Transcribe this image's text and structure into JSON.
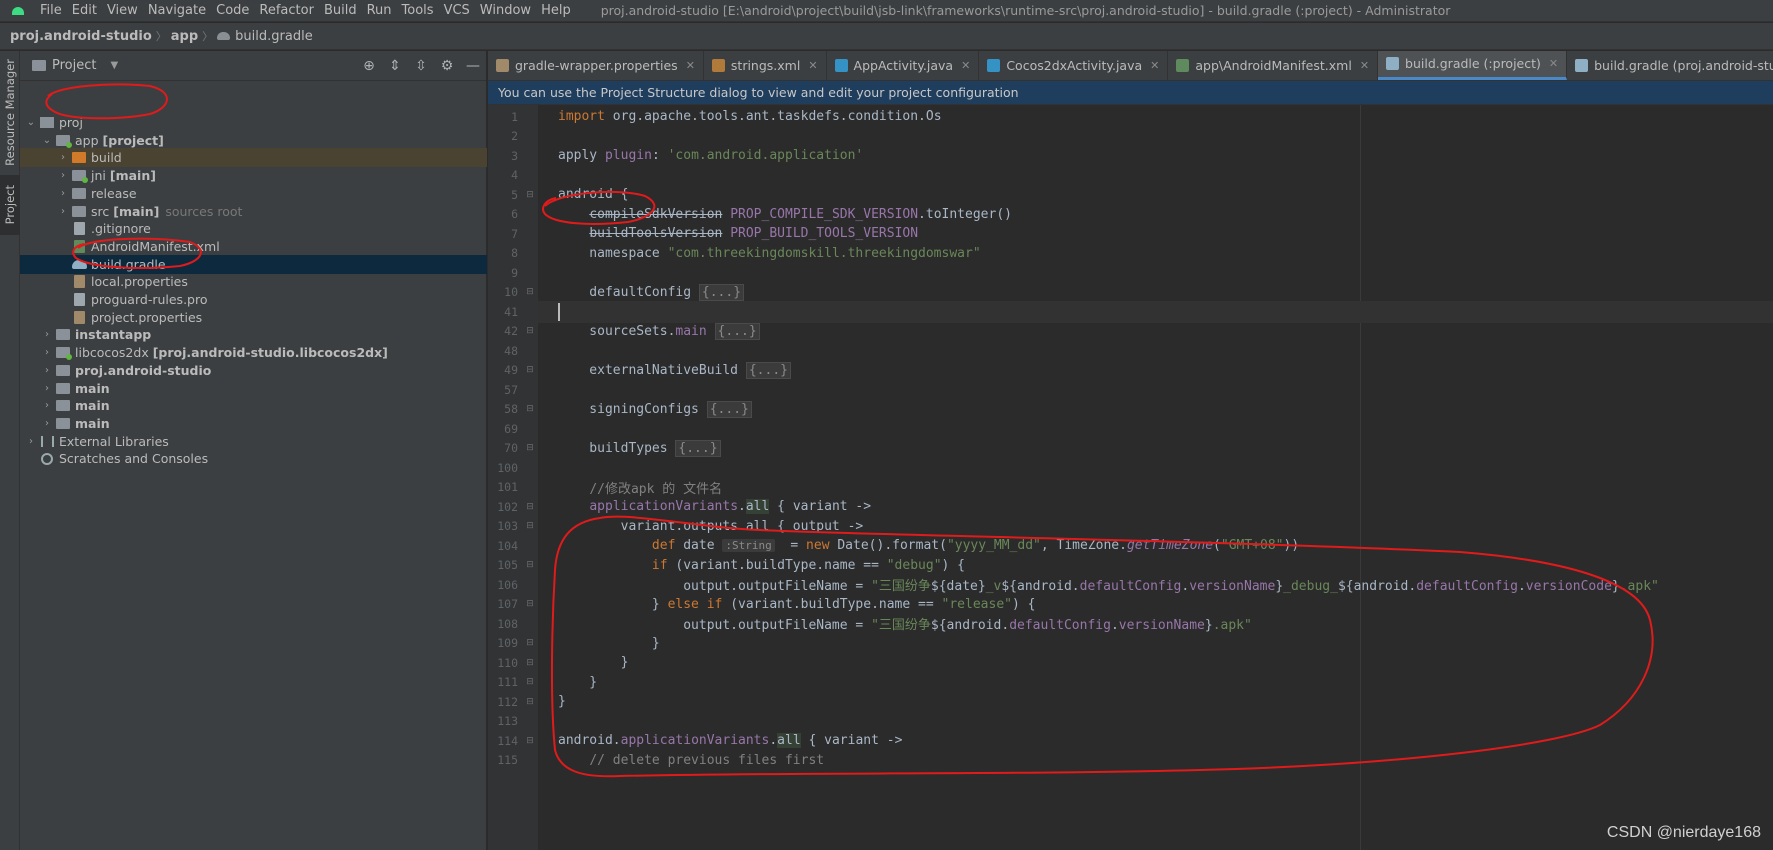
{
  "menu": {
    "items": [
      "File",
      "Edit",
      "View",
      "Navigate",
      "Code",
      "Refactor",
      "Build",
      "Run",
      "Tools",
      "VCS",
      "Window",
      "Help"
    ],
    "window_title": "proj.android-studio [E:\\android\\project\\build\\jsb-link\\frameworks\\runtime-src\\proj.android-studio] - build.gradle (:project) - Administrator"
  },
  "breadcrumb": [
    "proj.android-studio",
    "app",
    "build.gradle"
  ],
  "side_tabs": {
    "resource_manager": "Resource Manager",
    "project": "Project"
  },
  "panel": {
    "title": "Project"
  },
  "tree": [
    {
      "indent": 0,
      "arrow": "down",
      "icon": "project",
      "name": "proj",
      "bold": false
    },
    {
      "indent": 1,
      "arrow": "down",
      "icon": "module",
      "name": "app",
      "extra": "[project]",
      "bold": false
    },
    {
      "indent": 2,
      "arrow": "right",
      "icon": "folder-orange",
      "name": "build",
      "hl": "build"
    },
    {
      "indent": 2,
      "arrow": "right",
      "icon": "module",
      "name": "jni",
      "extra": "[main]"
    },
    {
      "indent": 2,
      "arrow": "right",
      "icon": "folder",
      "name": "release"
    },
    {
      "indent": 2,
      "arrow": "right",
      "icon": "folder",
      "name": "src",
      "extra": "[main]",
      "hint": "sources root"
    },
    {
      "indent": 2,
      "arrow": "",
      "icon": "file",
      "name": ".gitignore"
    },
    {
      "indent": 2,
      "arrow": "",
      "icon": "xml",
      "name": "AndroidManifest.xml"
    },
    {
      "indent": 2,
      "arrow": "",
      "icon": "gradle",
      "name": "build.gradle",
      "hl": "selected"
    },
    {
      "indent": 2,
      "arrow": "",
      "icon": "props",
      "name": "local.properties"
    },
    {
      "indent": 2,
      "arrow": "",
      "icon": "file",
      "name": "proguard-rules.pro"
    },
    {
      "indent": 2,
      "arrow": "",
      "icon": "props",
      "name": "project.properties"
    },
    {
      "indent": 1,
      "arrow": "right",
      "icon": "folder",
      "name": "instantapp",
      "bold": true
    },
    {
      "indent": 1,
      "arrow": "right",
      "icon": "module",
      "name": "libcocos2dx",
      "extra": "[proj.android-studio.libcocos2dx]"
    },
    {
      "indent": 1,
      "arrow": "right",
      "icon": "folder",
      "name": "proj.android-studio",
      "bold": true
    },
    {
      "indent": 1,
      "arrow": "right",
      "icon": "folder",
      "name": "main",
      "bold": true
    },
    {
      "indent": 1,
      "arrow": "right",
      "icon": "folder",
      "name": "main",
      "bold": true
    },
    {
      "indent": 1,
      "arrow": "right",
      "icon": "folder",
      "name": "main",
      "bold": true
    },
    {
      "indent": 0,
      "arrow": "right",
      "icon": "lib",
      "name": "External Libraries"
    },
    {
      "indent": 0,
      "arrow": "",
      "icon": "scratch",
      "name": "Scratches and Consoles"
    }
  ],
  "tabs": [
    {
      "label": "gradle-wrapper.properties",
      "color": "#a08a6a"
    },
    {
      "label": "strings.xml",
      "color": "#b07a3a"
    },
    {
      "label": "AppActivity.java",
      "color": "#3592c4"
    },
    {
      "label": "Cocos2dxActivity.java",
      "color": "#3592c4"
    },
    {
      "label": "app\\AndroidManifest.xml",
      "color": "#5e8a5e"
    },
    {
      "label": "build.gradle (:project)",
      "color": "#8fb0c4",
      "active": true
    },
    {
      "label": "build.gradle (proj.android-studio)",
      "color": "#8fb0c4"
    }
  ],
  "notice": "You can use the Project Structure dialog to view and edit your project configuration",
  "code_lines": [
    {
      "n": "1",
      "html": "<span class=\"kw\">import</span> org.apache.tools.ant.taskdefs.condition.Os"
    },
    {
      "n": "2",
      "html": ""
    },
    {
      "n": "3",
      "html": "apply <span class=\"prop\">plugin</span>: <span class=\"str\">'com.android.application'</span>"
    },
    {
      "n": "4",
      "html": ""
    },
    {
      "n": "5",
      "html": "android {",
      "fold": true
    },
    {
      "n": "6",
      "html": "    <span class=\"strike\">compileSdkVersion</span> <span class=\"prop\">PROP_COMPILE_SDK_VERSION</span>.toInteger()"
    },
    {
      "n": "7",
      "html": "    <span class=\"strike\">buildToolsVersion</span> <span class=\"prop\">PROP_BUILD_TOOLS_VERSION</span>"
    },
    {
      "n": "8",
      "html": "    namespace <span class=\"str\">\"com.threekingdomskill.threekingdomswar\"</span>"
    },
    {
      "n": "9",
      "html": ""
    },
    {
      "n": "10",
      "html": "    defaultConfig <span class=\"fold-box\">{...}</span>",
      "fold": true
    },
    {
      "n": "41",
      "html": "<span class=\"caret-bar\"></span>",
      "current": true
    },
    {
      "n": "42",
      "html": "    sourceSets.<span class=\"prop\">main</span> <span class=\"fold-box\">{...}</span>",
      "fold": true
    },
    {
      "n": "48",
      "html": ""
    },
    {
      "n": "49",
      "html": "    externalNativeBuild <span class=\"fold-box\">{...}</span>",
      "fold": true
    },
    {
      "n": "57",
      "html": ""
    },
    {
      "n": "58",
      "html": "    signingConfigs <span class=\"fold-box\">{...}</span>",
      "fold": true
    },
    {
      "n": "69",
      "html": ""
    },
    {
      "n": "70",
      "html": "    buildTypes <span class=\"fold-box\">{...}</span>",
      "fold": true
    },
    {
      "n": "100",
      "html": ""
    },
    {
      "n": "101",
      "html": "    <span class=\"cmt\">//修改apk 的 文件名</span>"
    },
    {
      "n": "102",
      "html": "    <span class=\"prop\">applicationVariants</span>.<span class=\"ref-hl\">all</span> { variant -&gt;",
      "fold": true
    },
    {
      "n": "103",
      "html": "        variant.outputs.all { output -&gt;",
      "fold": true
    },
    {
      "n": "104",
      "html": "            <span class=\"kw\">def</span> date <span class=\"hint-inline\">:String</span>  = <span class=\"kw\">new</span> Date().format(<span class=\"str\">\"yyyy_MM_dd\"</span>, TimeZone.<span class=\"itl\">getTimeZone</span>(<span class=\"str\">\"GMT+08\"</span>))"
    },
    {
      "n": "105",
      "html": "            <span class=\"kw\">if</span> (variant.buildType.name == <span class=\"str\">\"debug\"</span>) {",
      "fold": true
    },
    {
      "n": "106",
      "html": "                output.outputFileName = <span class=\"str\">\"三国纷争</span>${date}<span class=\"str\">_v</span>${android.<span class=\"prop\">defaultConfig</span>.<span class=\"prop\">versionName</span>}<span class=\"str\">_debug_</span>${android.<span class=\"prop\">defaultConfig</span>.<span class=\"prop\">versionCode</span>}<span class=\"str\">.apk\"</span>"
    },
    {
      "n": "107",
      "html": "            } <span class=\"kw\">else if</span> (variant.buildType.name == <span class=\"str\">\"release\"</span>) {",
      "fold": true
    },
    {
      "n": "108",
      "html": "                output.outputFileName = <span class=\"str\">\"三国纷争</span>${android.<span class=\"prop\">defaultConfig</span>.<span class=\"prop\">versionName</span>}<span class=\"str\">.apk\"</span>"
    },
    {
      "n": "109",
      "html": "            }",
      "fold": true
    },
    {
      "n": "110",
      "html": "        }",
      "fold": true
    },
    {
      "n": "111",
      "html": "    }",
      "fold": true
    },
    {
      "n": "112",
      "html": "}",
      "fold": true
    },
    {
      "n": "113",
      "html": ""
    },
    {
      "n": "114",
      "html": "android.<span class=\"prop\">applicationVariants</span>.<span class=\"ref-hl\">all</span> { variant -&gt;",
      "fold": true
    },
    {
      "n": "115",
      "html": "    <span class=\"cmt\">// delete previous files first</span>"
    }
  ],
  "watermark": "CSDN @nierdaye168"
}
